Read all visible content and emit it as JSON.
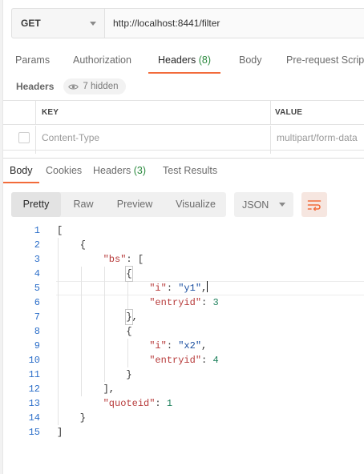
{
  "request": {
    "method": "GET",
    "url": "http://localhost:8441/filter"
  },
  "request_tabs": [
    {
      "label": "Params"
    },
    {
      "label": "Authorization"
    },
    {
      "label": "Headers ",
      "count": "(8)"
    },
    {
      "label": "Body"
    },
    {
      "label": "Pre-request Script"
    }
  ],
  "headers_section": {
    "title": "Headers",
    "hidden_label": "7 hidden"
  },
  "headers_table": {
    "columns": [
      "KEY",
      "VALUE"
    ],
    "rows": [
      {
        "key": "Content-Type",
        "value": "multipart/form-data"
      }
    ]
  },
  "response_tabs": [
    {
      "label": "Body"
    },
    {
      "label": "Cookies"
    },
    {
      "label": "Headers ",
      "count": "(3)"
    },
    {
      "label": "Test Results"
    }
  ],
  "view_modes": [
    "Pretty",
    "Raw",
    "Preview",
    "Visualize"
  ],
  "format": "JSON",
  "code_lines": [
    {
      "n": "1",
      "tokens": [
        [
          "p",
          "["
        ]
      ]
    },
    {
      "n": "2",
      "tokens": [
        [
          "p",
          "    {"
        ]
      ]
    },
    {
      "n": "3",
      "tokens": [
        [
          "p",
          "        "
        ],
        [
          "k",
          "\"bs\""
        ],
        [
          "p",
          ": ["
        ]
      ]
    },
    {
      "n": "4",
      "tokens": [
        [
          "p",
          "            "
        ],
        [
          "b",
          "{"
        ]
      ]
    },
    {
      "n": "5",
      "tokens": [
        [
          "p",
          "                "
        ],
        [
          "k",
          "\"i\""
        ],
        [
          "p",
          ": "
        ],
        [
          "s",
          "\"y1\""
        ],
        [
          "p",
          ","
        ],
        [
          "c",
          ""
        ]
      ]
    },
    {
      "n": "6",
      "tokens": [
        [
          "p",
          "                "
        ],
        [
          "k",
          "\"entryid\""
        ],
        [
          "p",
          ": "
        ],
        [
          "n",
          "3"
        ]
      ]
    },
    {
      "n": "7",
      "tokens": [
        [
          "p",
          "            "
        ],
        [
          "b",
          "}"
        ],
        [
          "p",
          ","
        ]
      ]
    },
    {
      "n": "8",
      "tokens": [
        [
          "p",
          "            {"
        ]
      ]
    },
    {
      "n": "9",
      "tokens": [
        [
          "p",
          "                "
        ],
        [
          "k",
          "\"i\""
        ],
        [
          "p",
          ": "
        ],
        [
          "s",
          "\"x2\""
        ],
        [
          "p",
          ","
        ]
      ]
    },
    {
      "n": "10",
      "tokens": [
        [
          "p",
          "                "
        ],
        [
          "k",
          "\"entryid\""
        ],
        [
          "p",
          ": "
        ],
        [
          "n",
          "4"
        ]
      ]
    },
    {
      "n": "11",
      "tokens": [
        [
          "p",
          "            }"
        ]
      ]
    },
    {
      "n": "12",
      "tokens": [
        [
          "p",
          "        ],"
        ]
      ]
    },
    {
      "n": "13",
      "tokens": [
        [
          "p",
          "        "
        ],
        [
          "k",
          "\"quoteid\""
        ],
        [
          "p",
          ": "
        ],
        [
          "n",
          "1"
        ]
      ]
    },
    {
      "n": "14",
      "tokens": [
        [
          "p",
          "    }"
        ]
      ]
    },
    {
      "n": "15",
      "tokens": [
        [
          "p",
          "]"
        ]
      ]
    }
  ],
  "colors": {
    "accent": "#f26b3a",
    "count": "#2b8a3e",
    "line_number": "#2b6ec9",
    "json_key": "#b73a3a",
    "json_string": "#1a4fa0",
    "json_number": "#1b7f5a"
  },
  "icons": {
    "method_dropdown": "chevron-down-icon",
    "hidden_headers": "eye-icon",
    "format_dropdown": "chevron-down-icon",
    "wrap": "wrap-lines-icon"
  }
}
